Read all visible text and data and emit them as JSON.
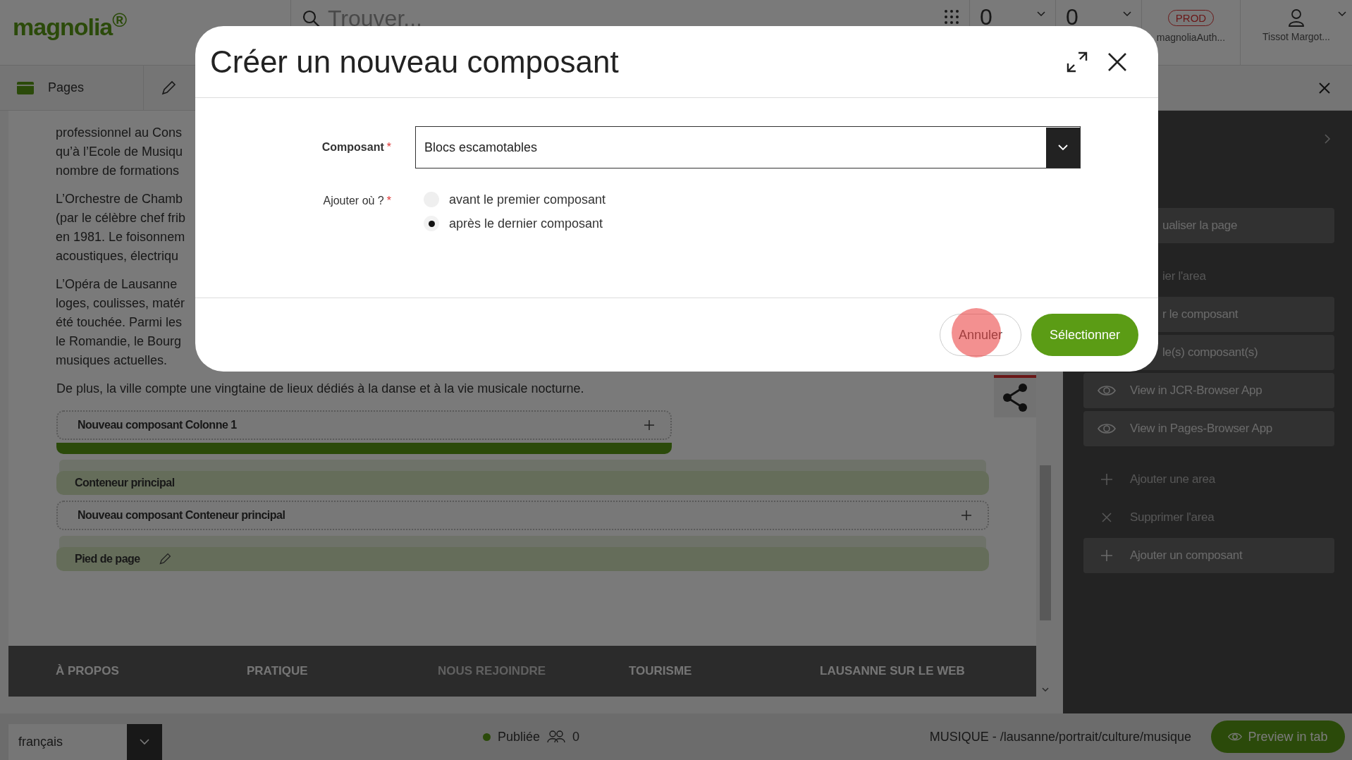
{
  "header": {
    "logo": "magnolia$^{®}$",
    "search": {
      "placeholder": "Trouver..."
    },
    "counters": [
      "0",
      "0"
    ],
    "environment": {
      "badge": "PROD",
      "instance": "magnoliaAuth..."
    },
    "user": {
      "name": "Tissot Margot..."
    }
  },
  "tabs": [
    {
      "label": "Pages",
      "kind": "app"
    },
    {
      "kind": "editor"
    }
  ],
  "page": {
    "paragraphs": [
      [
        "professionnel au Cons",
        "qu’à l’Ecole de Musiqu",
        "nombre de formations"
      ],
      [
        "L’Orchestre de Chamb",
        "(par le célèbre chef frib",
        "en 1981. Le foisonnem",
        "acoustiques, électriqu"
      ],
      [
        "L’Opéra de Lausanne",
        "loges, coulisses, matér",
        "été touchée. Parmi les",
        "le Romandie, le Bourg",
        "musiques actuelles."
      ]
    ],
    "closing": "De plus, la ville compte une vingtaine de lieux dédiés à la danse et à la vie musicale nocturne.",
    "blocks": [
      {
        "kind": "new",
        "label": "Nouveau composant Colonne 1",
        "wide": false
      },
      {
        "kind": "bar",
        "wide": false
      },
      {
        "kind": "area",
        "label": "Conteneur principal",
        "editable": false
      },
      {
        "kind": "new",
        "label": "Nouveau composant Conteneur principal",
        "wide": true
      },
      {
        "kind": "area",
        "label": "Pied de page",
        "editable": true
      }
    ],
    "footer_nav": [
      {
        "label": "À PROPOS",
        "muted": false
      },
      {
        "label": "PRATIQUE",
        "muted": false
      },
      {
        "label": "NOUS REJOINDRE",
        "muted": true
      },
      {
        "label": "TOURISME",
        "muted": false
      },
      {
        "label": "LAUSANNE SUR LE WEB",
        "muted": false
      }
    ]
  },
  "panel": {
    "sections": [
      [
        {
          "label": "ualiser la page",
          "kind": "covered",
          "disabled": false
        }
      ],
      [
        {
          "label": "ier l'area",
          "kind": "covered",
          "disabled": true
        },
        {
          "label": "r le composant",
          "kind": "covered",
          "disabled": false
        },
        {
          "label": "le(s) composant(s)",
          "kind": "covered",
          "disabled": false
        },
        {
          "label": "View in JCR-Browser App",
          "kind": "view",
          "disabled": false
        },
        {
          "label": "View in Pages-Browser App",
          "kind": "view",
          "disabled": false
        }
      ],
      [
        {
          "label": "Ajouter une area",
          "kind": "add",
          "disabled": true
        },
        {
          "label": "Supprimer l'area",
          "kind": "delete",
          "disabled": true
        },
        {
          "label": "Ajouter un composant",
          "kind": "add",
          "disabled": false
        }
      ]
    ]
  },
  "status_bar": {
    "language": "français",
    "status": "Publiée",
    "published": true,
    "users": "0",
    "path": "MUSIQUE - /lausanne/portrait/culture/musique",
    "preview_button": "Preview in tab"
  },
  "dialog": {
    "title": "Créer un nouveau composant",
    "fields": [
      {
        "kind": "select",
        "label": "Composant",
        "mark": "*",
        "value": "Blocs escamotables"
      },
      {
        "kind": "radio",
        "label": "Ajouter où ?",
        "mark": "*",
        "options": [
          {
            "label": "avant le premier composant",
            "selected": false
          },
          {
            "label": "après le dernier composant",
            "selected": true
          }
        ]
      }
    ],
    "buttons": [
      {
        "label": "Annuler",
        "kind": "secondary"
      },
      {
        "label": "Sélectionner",
        "kind": "primary"
      }
    ]
  }
}
